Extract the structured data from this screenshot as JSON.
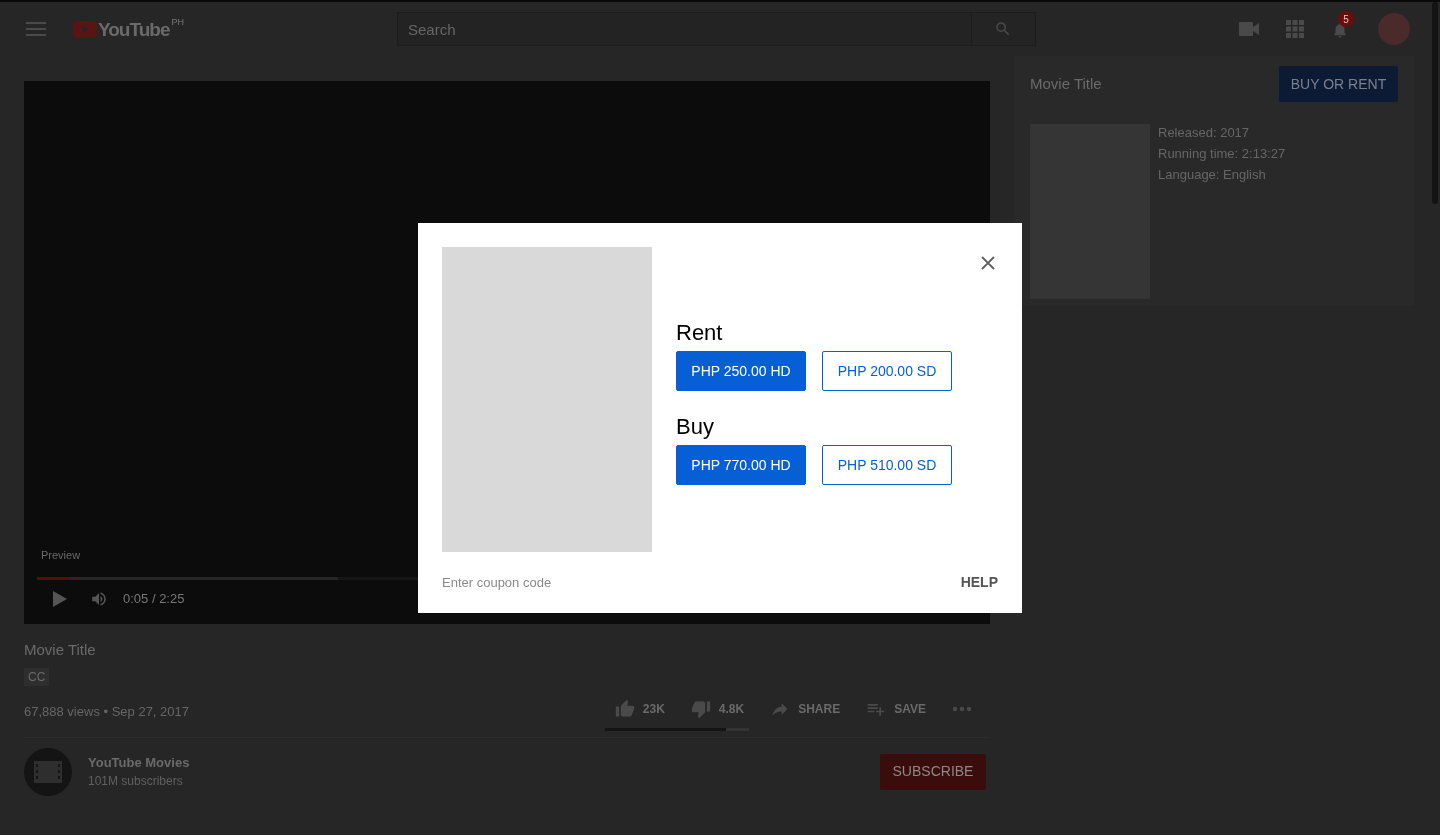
{
  "header": {
    "logo_text": "YouTube",
    "country": "PH",
    "search": {
      "placeholder": "Search"
    },
    "notification_count": "5"
  },
  "video": {
    "preview_label": "Preview",
    "time": "0:05 / 2:25",
    "progress": {
      "level": 0.035
    },
    "buffer": {
      "level": 0.32
    }
  },
  "info": {
    "title": "Movie Title",
    "badge": "CC",
    "meta": "67,888 views • Sep 27, 2017",
    "actions": [
      {
        "kind": "like",
        "label": "23K"
      },
      {
        "kind": "dislike",
        "label": "4.8K"
      },
      {
        "kind": "share",
        "label": "SHARE"
      },
      {
        "kind": "save",
        "label": "SAVE"
      },
      {
        "kind": "more"
      }
    ],
    "sentiment": {
      "level": 0.84
    },
    "channel": {
      "name": "YouTube Movies",
      "subscribers": "101M subscribers",
      "subscribe": "SUBSCRIBE"
    }
  },
  "sidebar": {
    "title": "Movie Title",
    "button": "BUY OR RENT",
    "details": [
      "Released: 2017",
      "Running time: 2:13:27",
      "Language: English"
    ]
  },
  "dialog": {
    "sections": [
      {
        "heading": "Rent",
        "options": [
          {
            "label": "PHP 250.00 HD",
            "kind": "filled"
          },
          {
            "label": "PHP 200.00 SD",
            "kind": "outlined"
          }
        ]
      },
      {
        "heading": "Buy",
        "options": [
          {
            "label": "PHP 770.00 HD",
            "kind": "filled"
          },
          {
            "label": "PHP 510.00 SD",
            "kind": "outlined"
          }
        ]
      }
    ],
    "coupon": {
      "placeholder": "Enter coupon code"
    },
    "help": "HELP"
  }
}
